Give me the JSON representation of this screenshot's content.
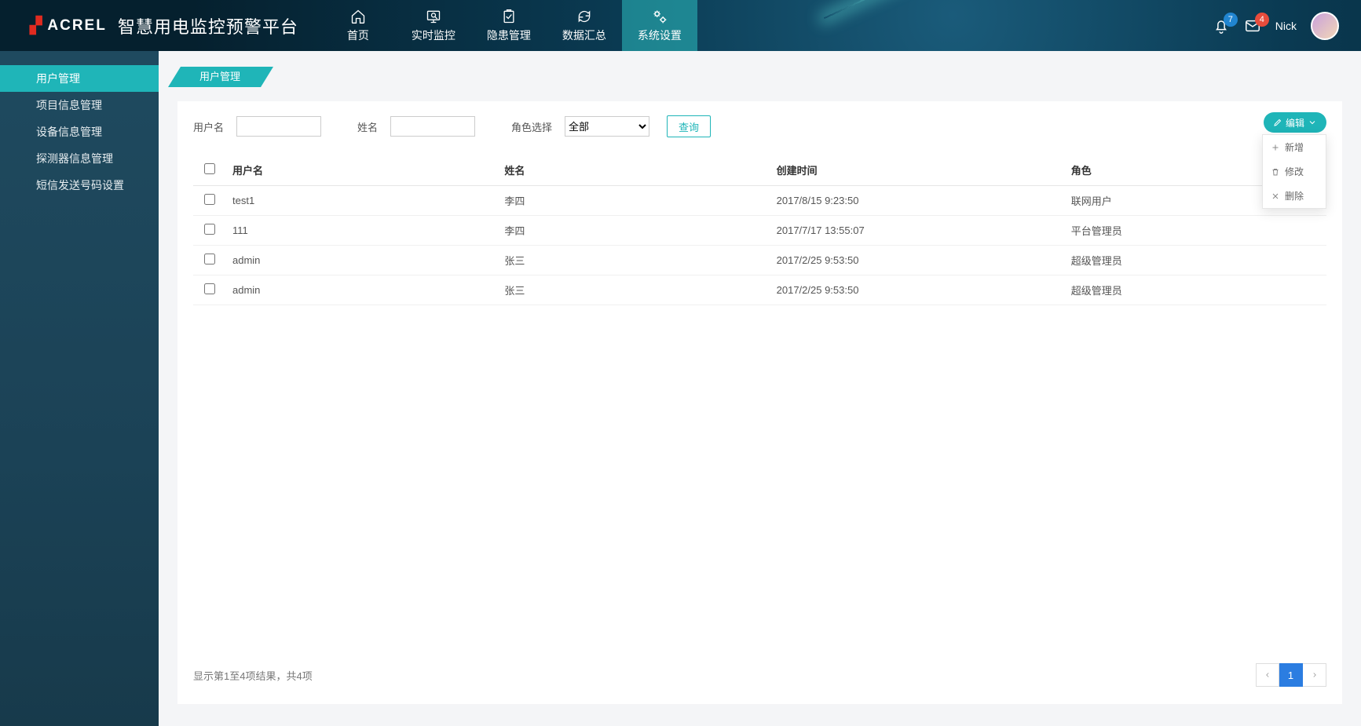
{
  "brand": {
    "mark": "▞",
    "name": "ACREL",
    "title": "智慧用电监控预警平台"
  },
  "nav": {
    "items": [
      {
        "label": "首页"
      },
      {
        "label": "实时监控"
      },
      {
        "label": "隐患管理"
      },
      {
        "label": "数据汇总"
      },
      {
        "label": "系统设置"
      }
    ],
    "active_index": 4
  },
  "notifications": {
    "bell_count": "7",
    "msg_count": "4"
  },
  "user": {
    "name": "Nick"
  },
  "sidebar": {
    "items": [
      {
        "label": "用户管理"
      },
      {
        "label": "项目信息管理"
      },
      {
        "label": "设备信息管理"
      },
      {
        "label": "探测器信息管理"
      },
      {
        "label": "短信发送号码设置"
      }
    ],
    "active_index": 0
  },
  "page": {
    "title": "用户管理"
  },
  "filters": {
    "username_label": "用户名",
    "realname_label": "姓名",
    "role_label": "角色选择",
    "role_value": "全部",
    "query_label": "查询"
  },
  "edit": {
    "button_label": "编辑",
    "menu": [
      {
        "label": "新增",
        "icon": "plus"
      },
      {
        "label": "修改",
        "icon": "edit"
      },
      {
        "label": "删除",
        "icon": "delete"
      }
    ]
  },
  "table": {
    "columns": [
      "用户名",
      "姓名",
      "创建时间",
      "角色"
    ],
    "rows": [
      {
        "username": "test1",
        "realname": "李四",
        "created": "2017/8/15 9:23:50",
        "role": "联网用户"
      },
      {
        "username": "111",
        "realname": "李四",
        "created": "2017/7/17 13:55:07",
        "role": "平台管理员"
      },
      {
        "username": "admin",
        "realname": "张三",
        "created": "2017/2/25 9:53:50",
        "role": "超级管理员"
      },
      {
        "username": "admin",
        "realname": "张三",
        "created": "2017/2/25 9:53:50",
        "role": "超级管理员"
      }
    ]
  },
  "footer": {
    "summary": "显示第1至4项结果，共4项",
    "current_page": "1"
  }
}
